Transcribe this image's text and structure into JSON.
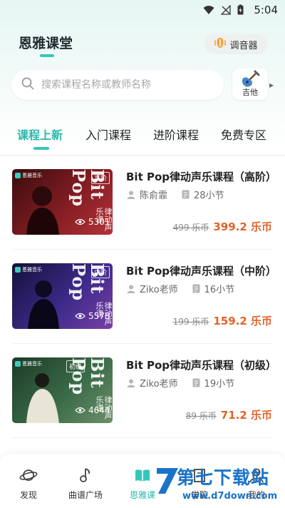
{
  "status_bar": {
    "time": "5:04"
  },
  "header": {
    "title": "恩雅课堂",
    "tuner_label": "调音器"
  },
  "search": {
    "placeholder": "搜索课程名称或教师名称"
  },
  "instrument": {
    "label": "吉他"
  },
  "tabs": [
    {
      "label": "课程上新",
      "active": true
    },
    {
      "label": "入门课程"
    },
    {
      "label": "进阶课程"
    },
    {
      "label": "免费专区"
    }
  ],
  "courses": [
    {
      "title": "Bit Pop律动声乐课程（高阶）",
      "teacher": "陈俞霏",
      "lessons": "28小节",
      "views": "5301",
      "old_price": "499 乐币",
      "price": "399.2 乐币",
      "level": "高阶",
      "thumb_art": "Bit Pop",
      "thumb_sub": "律动声乐课",
      "thumb_brand": "恩雅音乐",
      "theme": "#7a1a1f"
    },
    {
      "title": "Bit Pop律动声乐课程（中阶）",
      "teacher": "Ziko老师",
      "lessons": "16小节",
      "views": "5578",
      "old_price": "199 乐币",
      "price": "159.2 乐币",
      "level": "中阶",
      "thumb_art": "Bit Pop",
      "thumb_sub": "律动声乐课",
      "thumb_brand": "恩雅音乐",
      "theme": "#3a1f78"
    },
    {
      "title": "Bit Pop律动声乐课程（初级）",
      "teacher": "Ziko老师",
      "lessons": "19小节",
      "views": "4644",
      "old_price": "89 乐币",
      "price": "71.2 乐币",
      "level": "初级",
      "thumb_art": "Bit Pop",
      "thumb_sub": "律动声乐课",
      "thumb_brand": "恩雅音乐",
      "theme": "#2f5a3a"
    }
  ],
  "bottom_nav": [
    {
      "label": "发现",
      "icon": "planet-icon"
    },
    {
      "label": "曲谱广场",
      "icon": "music-note-icon"
    },
    {
      "label": "恩雅课",
      "icon": "book-icon",
      "active": true
    },
    {
      "label": "学院",
      "icon": "building-icon"
    },
    {
      "label": "我的",
      "icon": "user-icon"
    }
  ],
  "watermark": {
    "title": "第七下载站",
    "url": "www.d7down.com"
  },
  "colors": {
    "accent": "#35c7b9",
    "price": "#e1622b"
  }
}
